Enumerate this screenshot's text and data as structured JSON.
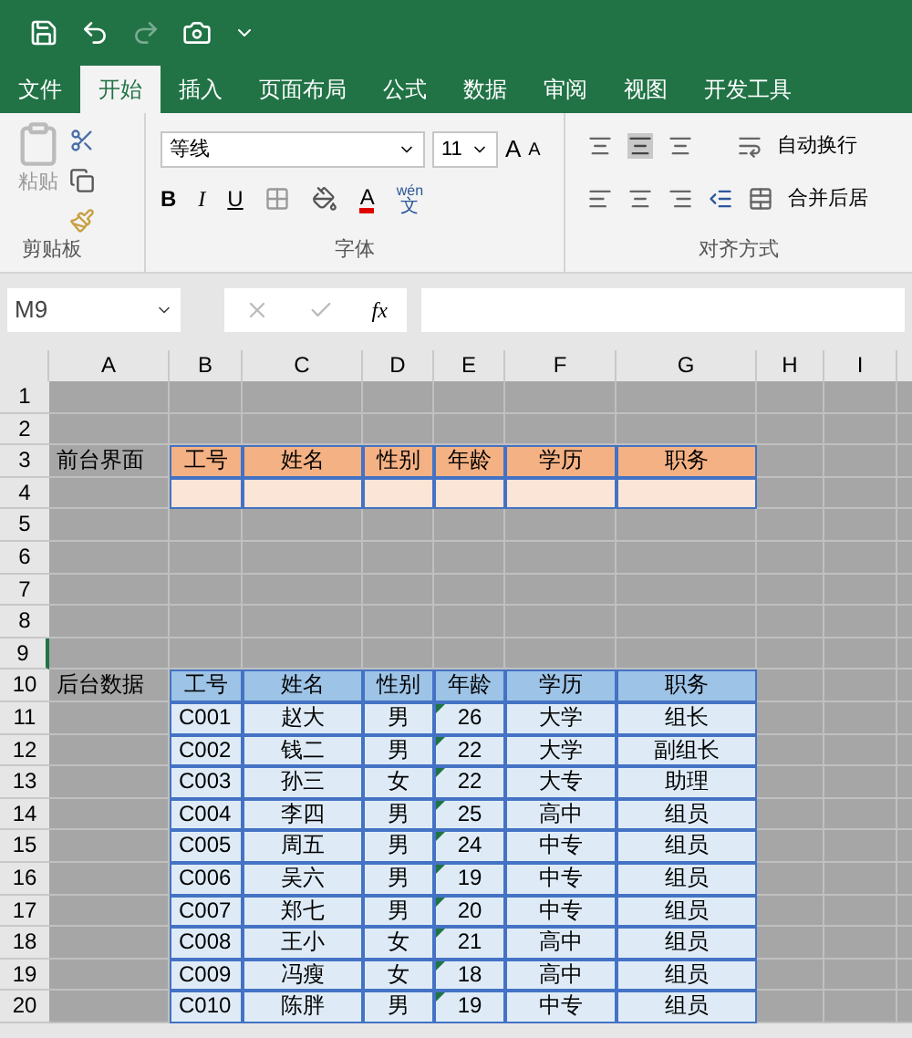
{
  "tabs": [
    {
      "label": "文件",
      "selected": false
    },
    {
      "label": "开始",
      "selected": true
    },
    {
      "label": "插入",
      "selected": false
    },
    {
      "label": "页面布局",
      "selected": false
    },
    {
      "label": "公式",
      "selected": false
    },
    {
      "label": "数据",
      "selected": false
    },
    {
      "label": "审阅",
      "selected": false
    },
    {
      "label": "视图",
      "selected": false
    },
    {
      "label": "开发工具",
      "selected": false
    }
  ],
  "ribbon": {
    "clipboard": {
      "paste": "粘贴",
      "label": "剪贴板"
    },
    "font": {
      "font_name": "等线",
      "font_size": "11",
      "grow": "A",
      "shrink": "A",
      "bold": "B",
      "italic": "I",
      "underline": "U",
      "font_color": "A",
      "phonetic_top": "wén",
      "phonetic_bottom": "文",
      "label": "字体"
    },
    "alignment": {
      "wrap_text": "自动换行",
      "merge": "合并后居",
      "label": "对齐方式"
    }
  },
  "formula_bar": {
    "name_box": "M9",
    "fx": "fx"
  },
  "sheet": {
    "columns": [
      "A",
      "B",
      "C",
      "D",
      "E",
      "F",
      "G",
      "H",
      "I"
    ],
    "rows": [
      {
        "number": "1",
        "selected": false,
        "kind": "plain"
      },
      {
        "number": "2",
        "selected": false,
        "kind": "plain"
      },
      {
        "number": "3",
        "selected": false,
        "label": "前台界面",
        "kind": "orange_header",
        "values": [
          "工号",
          "姓名",
          "性别",
          "年龄",
          "学历",
          "职务"
        ]
      },
      {
        "number": "4",
        "selected": false,
        "kind": "orange_input"
      },
      {
        "number": "5",
        "selected": false,
        "kind": "plain"
      },
      {
        "number": "6",
        "selected": false,
        "kind": "plain"
      },
      {
        "number": "7",
        "selected": false,
        "kind": "plain"
      },
      {
        "number": "8",
        "selected": false,
        "kind": "plain"
      },
      {
        "number": "9",
        "selected": true,
        "kind": "plain"
      },
      {
        "number": "10",
        "selected": false,
        "label": "后台数据",
        "kind": "blue_header",
        "values": [
          "工号",
          "姓名",
          "性别",
          "年龄",
          "学历",
          "职务"
        ]
      },
      {
        "number": "11",
        "selected": false,
        "kind": "blue_data",
        "values": [
          "C001",
          "赵大",
          "男",
          "26",
          "大学",
          "组长"
        ]
      },
      {
        "number": "12",
        "selected": false,
        "kind": "blue_data",
        "values": [
          "C002",
          "钱二",
          "男",
          "22",
          "大学",
          "副组长"
        ]
      },
      {
        "number": "13",
        "selected": false,
        "kind": "blue_data",
        "values": [
          "C003",
          "孙三",
          "女",
          "22",
          "大专",
          "助理"
        ]
      },
      {
        "number": "14",
        "selected": false,
        "kind": "blue_data",
        "values": [
          "C004",
          "李四",
          "男",
          "25",
          "高中",
          "组员"
        ]
      },
      {
        "number": "15",
        "selected": false,
        "kind": "blue_data",
        "values": [
          "C005",
          "周五",
          "男",
          "24",
          "中专",
          "组员"
        ]
      },
      {
        "number": "16",
        "selected": false,
        "kind": "blue_data",
        "values": [
          "C006",
          "吴六",
          "男",
          "19",
          "中专",
          "组员"
        ]
      },
      {
        "number": "17",
        "selected": false,
        "kind": "blue_data",
        "values": [
          "C007",
          "郑七",
          "男",
          "20",
          "中专",
          "组员"
        ]
      },
      {
        "number": "18",
        "selected": false,
        "kind": "blue_data",
        "values": [
          "C008",
          "王小",
          "女",
          "21",
          "高中",
          "组员"
        ]
      },
      {
        "number": "19",
        "selected": false,
        "kind": "blue_data",
        "values": [
          "C009",
          "冯瘦",
          "女",
          "18",
          "高中",
          "组员"
        ]
      },
      {
        "number": "20",
        "selected": false,
        "kind": "blue_data",
        "values": [
          "C010",
          "陈胖",
          "男",
          "19",
          "中专",
          "组员"
        ]
      }
    ]
  }
}
